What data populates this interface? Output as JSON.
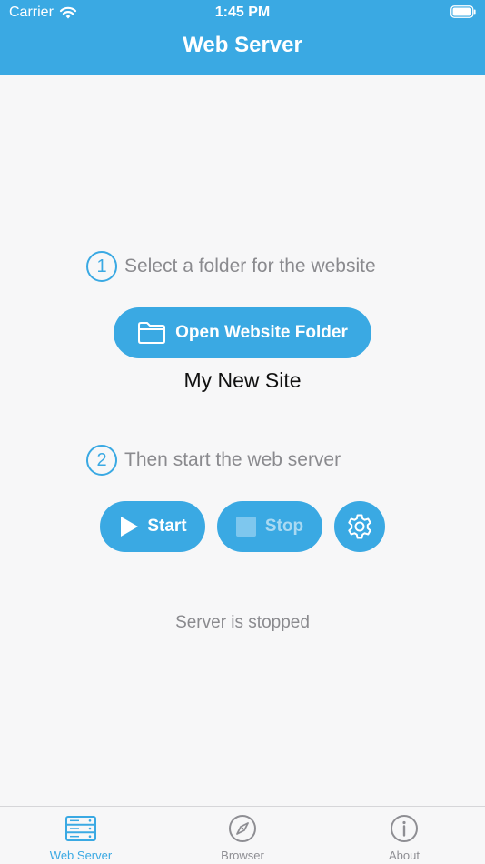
{
  "status_bar": {
    "carrier": "Carrier",
    "time": "1:45 PM"
  },
  "nav": {
    "title": "Web Server"
  },
  "step1": {
    "number": "1",
    "text": "Select a folder for the website"
  },
  "open_folder_button": {
    "label": "Open Website Folder",
    "icon": "folder-icon"
  },
  "folder_name": "My New Site",
  "step2": {
    "number": "2",
    "text": "Then start the web server"
  },
  "start_button": {
    "label": "Start",
    "icon": "play-icon"
  },
  "stop_button": {
    "label": "Stop",
    "icon": "stop-icon",
    "enabled": false
  },
  "settings_button": {
    "icon": "gear-icon"
  },
  "server_status": "Server is stopped",
  "tabs": [
    {
      "label": "Web Server",
      "icon": "server-icon",
      "selected": true
    },
    {
      "label": "Browser",
      "icon": "compass-icon",
      "selected": false
    },
    {
      "label": "About",
      "icon": "info-icon",
      "selected": false
    }
  ],
  "colors": {
    "accent": "#3aa9e3",
    "secondary_text": "#8a8a8e",
    "background": "#f7f7f8"
  }
}
